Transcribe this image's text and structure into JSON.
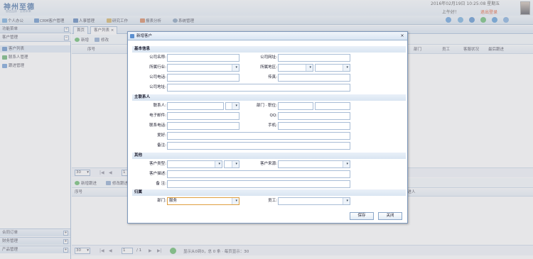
{
  "header": {
    "logo": "神州至德",
    "logo_sub": "智造品质 · 至德未来",
    "datetime": "2016年02月19日 10:25:08 星期五",
    "greeting": "上午好！",
    "logout": "退出登录"
  },
  "menu": [
    "个人办公",
    "CRM客户管理",
    "人事管理",
    "研究工作",
    "报表分析",
    "系统管理"
  ],
  "nav": {
    "title": "功能菜单",
    "section": "客户管理",
    "items": [
      "客户列表",
      "联系人管理",
      "跟进管理"
    ],
    "bottom": [
      "合同订单",
      "财务管理",
      "产品管理"
    ]
  },
  "tabs": [
    "首页",
    "客户列表"
  ],
  "toolbar": [
    "新增",
    "修改"
  ],
  "grid1": {
    "cols": [
      "序号"
    ],
    "right_cols": [
      "部门",
      "员工",
      "客服状况",
      "最后跟进"
    ]
  },
  "pager1": {
    "page_size": "30",
    "page": "1"
  },
  "toolbar2": [
    "新增跟进",
    "修改跟进"
  ],
  "grid2": {
    "cols": [
      "序号"
    ],
    "right_cols": [
      "跟进人"
    ]
  },
  "pager2": {
    "page_size": "30",
    "page": "1",
    "of": "/ 1",
    "status": "显示从0到0，总 0 条 · 每页显示：30"
  },
  "dialog": {
    "title": "新增客户",
    "sections": {
      "basic": "基本信息",
      "contact": "主联系人",
      "other": "其他",
      "ownership": "归属"
    },
    "labels": {
      "company_name": "公司名称:",
      "company_site": "公司网址:",
      "industry": "所属行业:",
      "region": "所属地区:",
      "company_phone": "公司电话:",
      "fax": "传真:",
      "company_address": "公司地址:",
      "contact": "联系人:",
      "dept_title": "部门 · 职位:",
      "email": "电子邮件:",
      "qq": "QQ:",
      "contact_phone": "联系电话:",
      "mobile": "手机:",
      "hobby": "爱好:",
      "notes": "备注:",
      "customer_type": "客户类型:",
      "customer_source": "客户来源:",
      "customer_desc": "客户描述:",
      "remark": "备  注:",
      "dept": "部门:",
      "staff": "员工:"
    },
    "values": {
      "dept": "服务"
    },
    "buttons": {
      "save": "保存",
      "close": "关闭"
    }
  },
  "colors": {
    "accent": "#2a5c9a",
    "logout": "#dd3300",
    "panel_border": "#99b3d1"
  }
}
